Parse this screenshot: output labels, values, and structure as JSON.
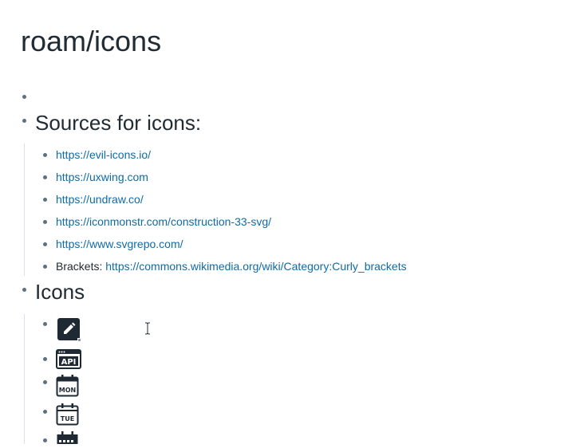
{
  "page": {
    "title": "roam/icons"
  },
  "blocks": {
    "sources_heading": "Sources for icons:",
    "sources": [
      {
        "prefix": "",
        "link": "https://evil-icons.io/"
      },
      {
        "prefix": "",
        "link": "https://uxwing.com"
      },
      {
        "prefix": "",
        "link": "https://undraw.co/"
      },
      {
        "prefix": "",
        "link": "https://iconmonstr.com/construction-33-svg/"
      },
      {
        "prefix": "",
        "link": "https://www.svgrepo.com/"
      },
      {
        "prefix": "Brackets: ",
        "link": "https://commons.wikimedia.org/wiki/Category:Curly_brackets"
      }
    ],
    "icons_heading": "Icons",
    "icons": [
      {
        "name": "pencil-edit-icon"
      },
      {
        "name": "api-icon",
        "label": "API"
      },
      {
        "name": "calendar-mon-icon",
        "label": "MON"
      },
      {
        "name": "calendar-tue-icon",
        "label": "TUE"
      },
      {
        "name": "calendar-grid-icon"
      }
    ]
  },
  "colors": {
    "text": "#202b33",
    "link": "#106ba3",
    "bullet": "#5c7080",
    "child_line": "#d8e1e8",
    "icon": "#1f2933"
  }
}
